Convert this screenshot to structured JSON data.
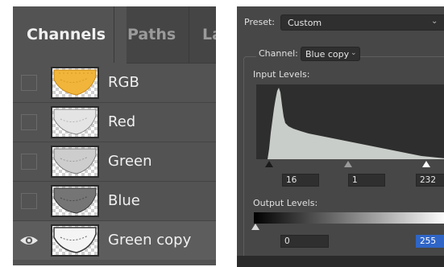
{
  "channels_panel": {
    "tabs": [
      {
        "label": "Channels",
        "active": true
      },
      {
        "label": "Paths",
        "active": false
      },
      {
        "label": "La",
        "active": false
      }
    ],
    "rows": [
      {
        "label": "RGB",
        "visible": false,
        "thumb_color": "#f0b53a"
      },
      {
        "label": "Red",
        "visible": false,
        "thumb_color": "#d8d8d8"
      },
      {
        "label": "Green",
        "visible": false,
        "thumb_color": "#c8c8c8"
      },
      {
        "label": "Blue",
        "visible": false,
        "thumb_color": "#6e6e6e"
      },
      {
        "label": "Green copy",
        "visible": true,
        "thumb_color": "#f2f2f2"
      }
    ]
  },
  "levels": {
    "preset_label": "Preset:",
    "preset_value": "Custom",
    "channel_label": "Channel:",
    "channel_value": "Blue copy",
    "input_levels_label": "Input Levels:",
    "input_levels": {
      "shadow": "16",
      "midtone": "1",
      "highlight": "232"
    },
    "output_levels_label": "Output Levels:",
    "output_levels": {
      "low": "0",
      "high": "255"
    }
  },
  "colors": {
    "panel_bg": "#535353",
    "dialog_bg": "#474747",
    "histogram_fill": "#c9cdc9",
    "selection_blue": "#2f65c7"
  }
}
